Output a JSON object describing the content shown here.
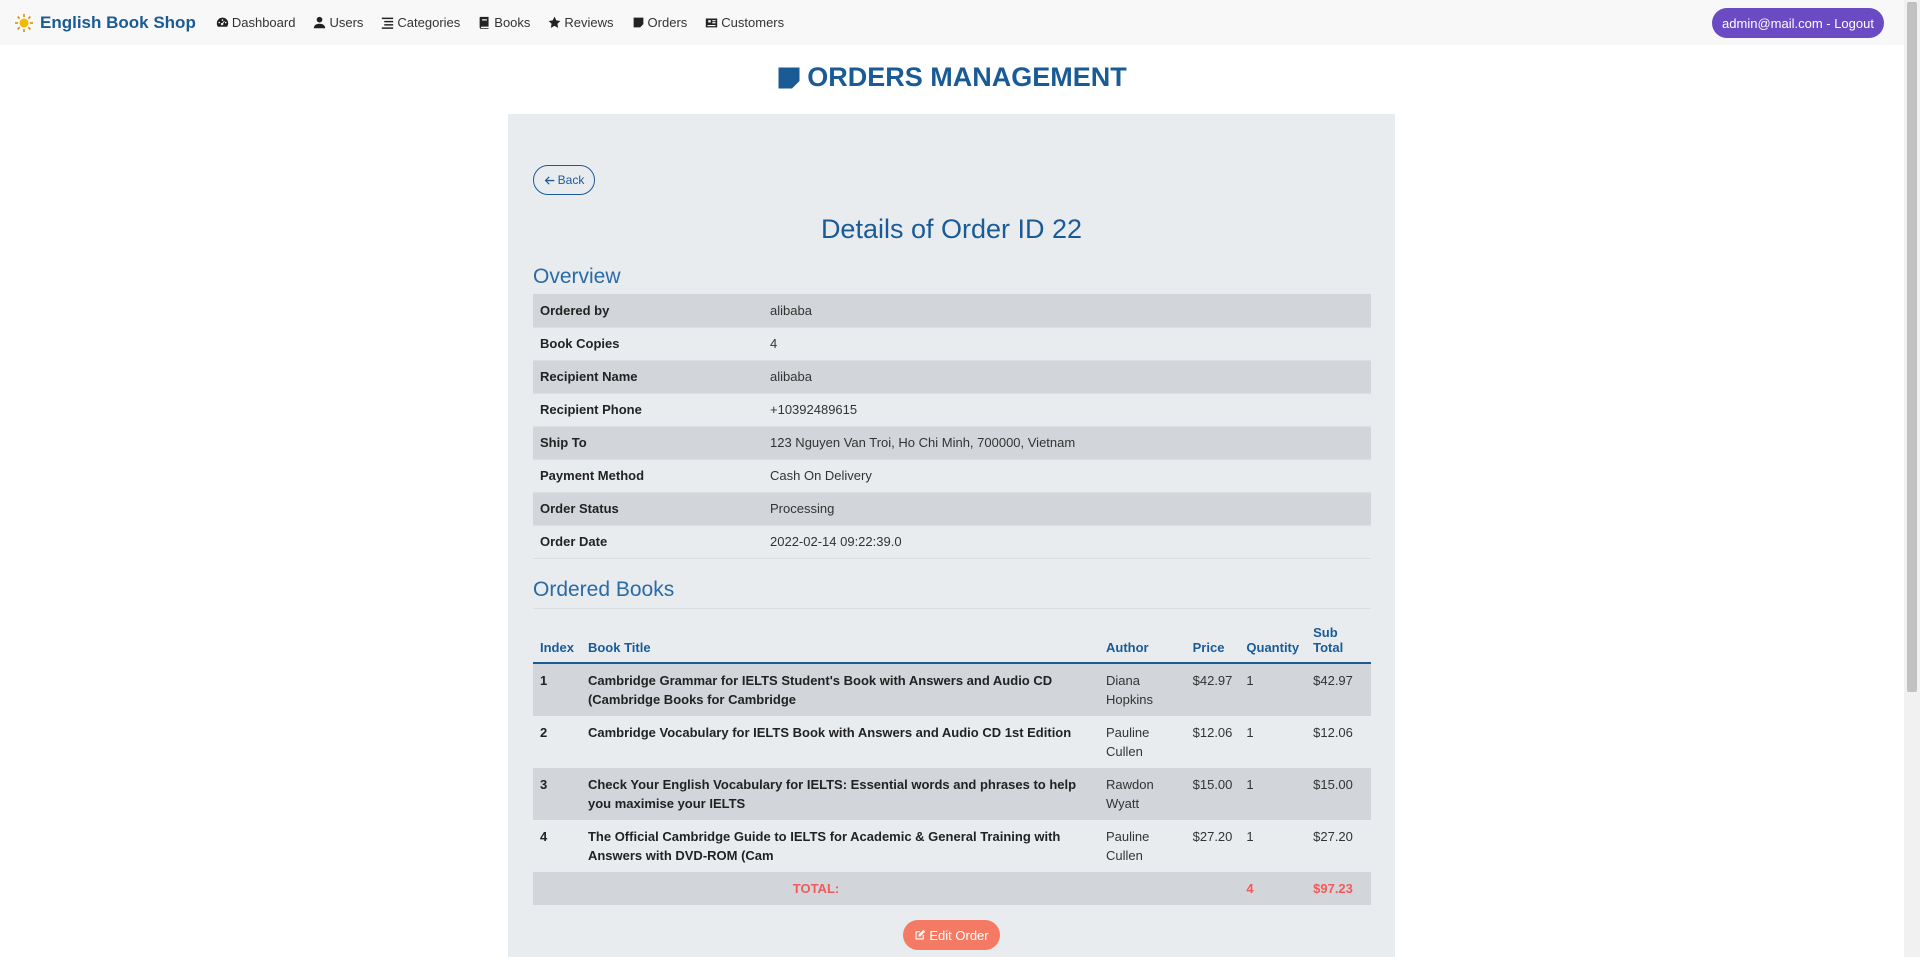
{
  "navbar": {
    "brand": "English Book Shop",
    "items": [
      {
        "label": "Dashboard",
        "icon": "dashboard-icon"
      },
      {
        "label": "Users",
        "icon": "user-icon"
      },
      {
        "label": "Categories",
        "icon": "list-icon"
      },
      {
        "label": "Books",
        "icon": "book-icon"
      },
      {
        "label": "Reviews",
        "icon": "star-icon"
      },
      {
        "label": "Orders",
        "icon": "order-icon"
      },
      {
        "label": "Customers",
        "icon": "customers-icon"
      }
    ],
    "logout": "admin@mail.com - Logout"
  },
  "page": {
    "title": "ORDERS MANAGEMENT"
  },
  "card": {
    "back_label": "Back",
    "details_title": "Details of Order ID 22",
    "overview_title": "Overview",
    "overview": [
      {
        "label": "Ordered by",
        "value": "alibaba"
      },
      {
        "label": "Book Copies",
        "value": "4"
      },
      {
        "label": "Recipient Name",
        "value": "alibaba"
      },
      {
        "label": "Recipient Phone",
        "value": "+10392489615"
      },
      {
        "label": "Ship To",
        "value": "123 Nguyen Van Troi, Ho Chi Minh, 700000, Vietnam"
      },
      {
        "label": "Payment Method",
        "value": "Cash On Delivery"
      },
      {
        "label": "Order Status",
        "value": "Processing"
      },
      {
        "label": "Order Date",
        "value": "2022-02-14 09:22:39.0"
      }
    ],
    "books_title": "Ordered Books",
    "columns": {
      "index": "Index",
      "title": "Book Title",
      "author": "Author",
      "price": "Price",
      "quantity": "Quantity",
      "subtotal": "Sub Total"
    },
    "books": [
      {
        "index": "1",
        "title": "Cambridge Grammar for IELTS Student's Book with Answers and Audio CD (Cambridge Books for Cambridge",
        "author": "Diana Hopkins",
        "price": "$42.97",
        "quantity": "1",
        "subtotal": "$42.97"
      },
      {
        "index": "2",
        "title": "Cambridge Vocabulary for IELTS Book with Answers and Audio CD 1st Edition",
        "author": "Pauline Cullen",
        "price": "$12.06",
        "quantity": "1",
        "subtotal": "$12.06"
      },
      {
        "index": "3",
        "title": "Check Your English Vocabulary for IELTS: Essential words and phrases to help you maximise your IELTS",
        "author": "Rawdon Wyatt",
        "price": "$15.00",
        "quantity": "1",
        "subtotal": "$15.00"
      },
      {
        "index": "4",
        "title": "The Official Cambridge Guide to IELTS for Academic & General Training with Answers with DVD-ROM (Cam",
        "author": "Pauline Cullen",
        "price": "$27.20",
        "quantity": "1",
        "subtotal": "$27.20"
      }
    ],
    "total": {
      "label": "TOTAL:",
      "quantity": "4",
      "amount": "$97.23"
    },
    "edit_label": "Edit Order"
  },
  "colors": {
    "primary": "#1a5b96",
    "logout": "#6a4bc4",
    "edit": "#f47a63",
    "total": "#f25a5a",
    "card_bg": "#e9ecef",
    "stripe": "#d2d6da"
  }
}
